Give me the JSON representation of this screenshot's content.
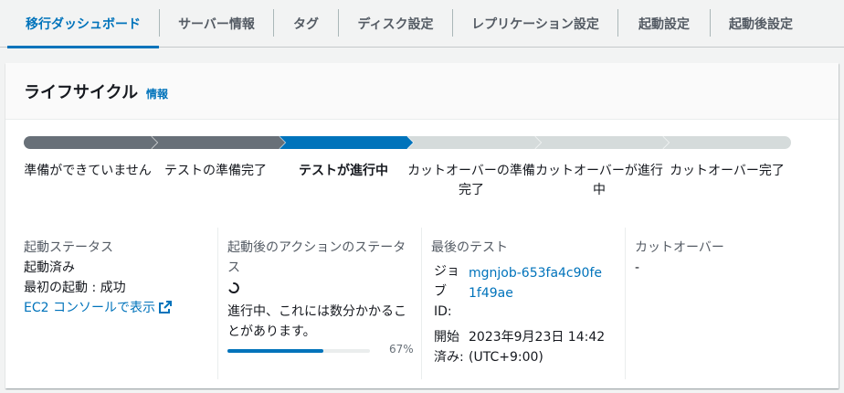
{
  "tabs": [
    {
      "label": "移行ダッシュボード",
      "active": true
    },
    {
      "label": "サーバー情報",
      "active": false
    },
    {
      "label": "タグ",
      "active": false
    },
    {
      "label": "ディスク設定",
      "active": false
    },
    {
      "label": "レプリケーション設定",
      "active": false
    },
    {
      "label": "起動設定",
      "active": false
    },
    {
      "label": "起動後設定",
      "active": false
    }
  ],
  "lifecycle": {
    "title": "ライフサイクル",
    "info_link": "情報",
    "steps": [
      {
        "label": "準備ができていません",
        "state": "complete"
      },
      {
        "label": "テストの準備完了",
        "state": "complete"
      },
      {
        "label": "テストが進行中",
        "state": "current"
      },
      {
        "label": "カットオーバーの準備完了",
        "state": "pending"
      },
      {
        "label": "カットオーバーが進行中",
        "state": "pending"
      },
      {
        "label": "カットオーバー完了",
        "state": "pending"
      }
    ],
    "colors": {
      "complete": "#687078",
      "current": "#0073bb",
      "pending": "#d5dbdb",
      "chevron": "#ffffff"
    }
  },
  "launch_status": {
    "title": "起動ステータス",
    "status": "起動済み",
    "first_launch": "最初の起動 : 成功",
    "console_link": "EC2 コンソールで表示"
  },
  "post_launch": {
    "title": "起動後のアクションのステータス",
    "message": "進行中、これには数分かかることがあります。",
    "progress_percent": 67,
    "progress_label": "67%"
  },
  "last_test": {
    "title": "最後のテスト",
    "job_id_key": "ジョブ ID:",
    "job_id_value": "mgnjob-653fa4c90fe1f49ae",
    "started_key": "開始済み:",
    "started_value": "2023年9月23日 14:42 (UTC+9:00)"
  },
  "cutover": {
    "title": "カットオーバー",
    "value": "-"
  }
}
